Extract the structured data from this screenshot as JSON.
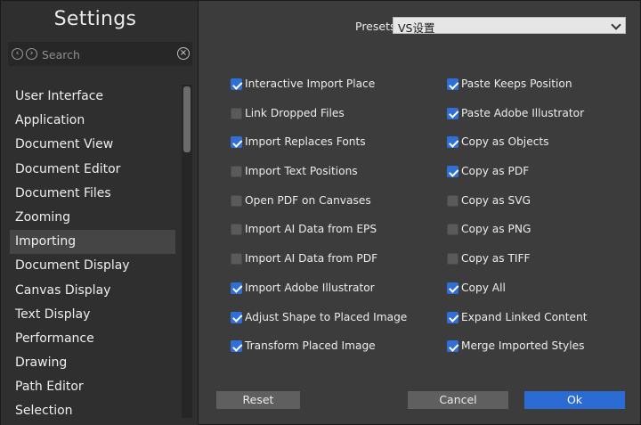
{
  "sidebar": {
    "title": "Settings",
    "search_placeholder": "Search",
    "items": [
      {
        "label": "User Interface"
      },
      {
        "label": "Application"
      },
      {
        "label": "Document View"
      },
      {
        "label": "Document Editor"
      },
      {
        "label": "Document Files"
      },
      {
        "label": "Zooming"
      },
      {
        "label": "Importing",
        "selected": true
      },
      {
        "label": "Document Display"
      },
      {
        "label": "Canvas Display"
      },
      {
        "label": "Text Display"
      },
      {
        "label": "Performance"
      },
      {
        "label": "Drawing"
      },
      {
        "label": "Path Editor"
      },
      {
        "label": "Selection"
      }
    ]
  },
  "presets": {
    "label": "Presets",
    "value": "VS设置"
  },
  "options_left": [
    {
      "label": "Interactive Import Place",
      "checked": true
    },
    {
      "label": "Link Dropped Files",
      "checked": false
    },
    {
      "label": "Import Replaces Fonts",
      "checked": true
    },
    {
      "label": "Import Text Positions",
      "checked": false
    },
    {
      "label": "Open PDF on Canvases",
      "checked": false
    },
    {
      "label": "Import AI Data from EPS",
      "checked": false
    },
    {
      "label": "Import AI Data from PDF",
      "checked": false
    },
    {
      "label": "Import Adobe Illustrator",
      "checked": true
    },
    {
      "label": "Adjust Shape to Placed Image",
      "checked": true
    },
    {
      "label": "Transform Placed Image",
      "checked": true
    }
  ],
  "options_right": [
    {
      "label": "Paste Keeps Position",
      "checked": true
    },
    {
      "label": "Paste Adobe Illustrator",
      "checked": true
    },
    {
      "label": "Copy as Objects",
      "checked": true
    },
    {
      "label": "Copy as PDF",
      "checked": true
    },
    {
      "label": "Copy as SVG",
      "checked": false
    },
    {
      "label": "Copy as PNG",
      "checked": false
    },
    {
      "label": "Copy as TIFF",
      "checked": false
    },
    {
      "label": "Copy All",
      "checked": true
    },
    {
      "label": "Expand Linked Content",
      "checked": true
    },
    {
      "label": "Merge Imported Styles",
      "checked": true
    }
  ],
  "buttons": {
    "reset": "Reset",
    "cancel": "Cancel",
    "ok": "Ok"
  },
  "colors": {
    "accent": "#2b6bd4",
    "panel": "#3c3c3c",
    "sidebar": "#2f2f2f"
  },
  "icons": {
    "back": "circle-chevron-left-icon",
    "forward": "circle-chevron-right-icon",
    "clear": "circle-x-icon",
    "dropdown": "chevron-down-icon",
    "checkbox": "checkmark-icon"
  }
}
